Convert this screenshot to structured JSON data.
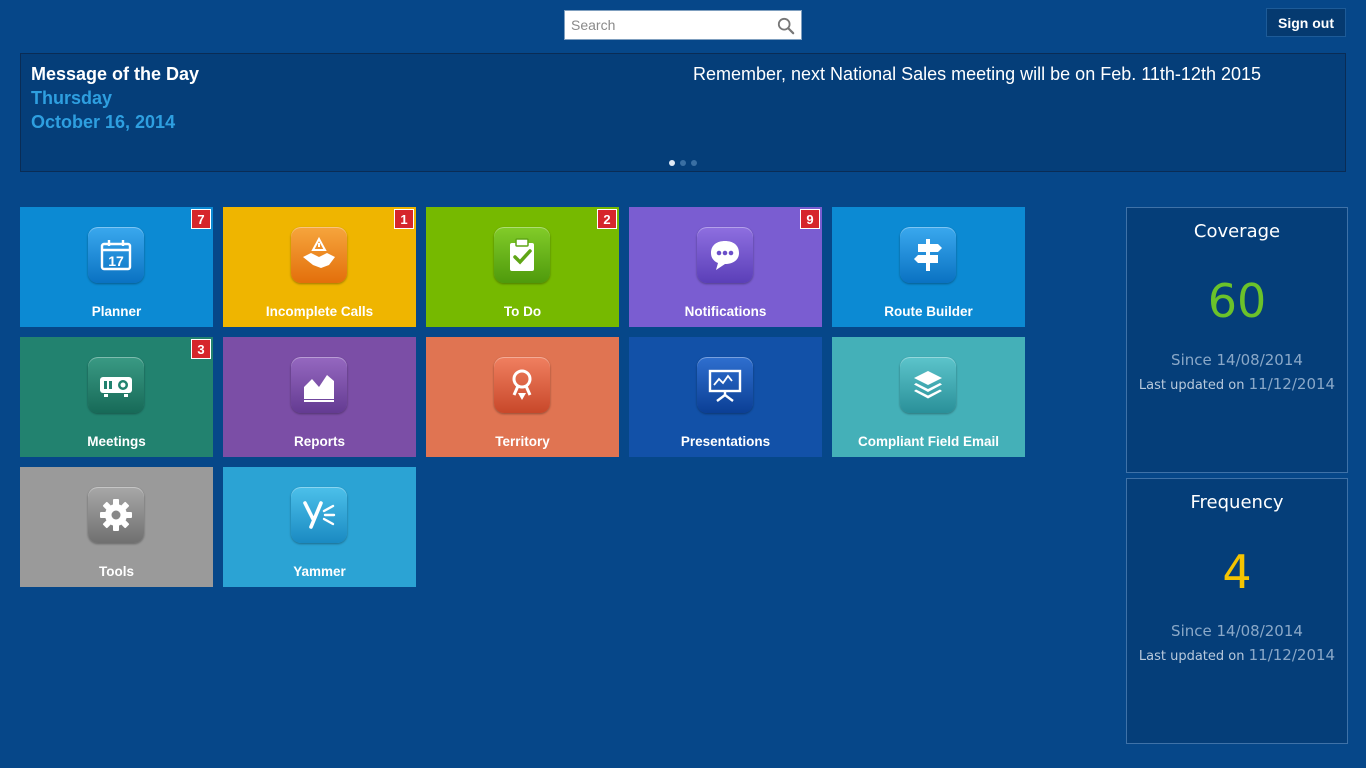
{
  "header": {
    "search_placeholder": "Search",
    "sign_out_label": "Sign out"
  },
  "message_of_the_day": {
    "title": "Message of the Day",
    "day": "Thursday",
    "date": "October 16, 2014",
    "message": "Remember, next National Sales meeting will be on Feb. 11th-12th 2015",
    "pager_dots": 3,
    "active_dot": 1
  },
  "tiles": [
    {
      "label": "Planner",
      "badge": "7",
      "color": "#0c8ad3",
      "icon": "calendar-icon"
    },
    {
      "label": "Incomplete Calls",
      "badge": "1",
      "color": "#efb500",
      "icon": "handshake-icon"
    },
    {
      "label": "To Do",
      "badge": "2",
      "color": "#76b900",
      "icon": "clipboard-check-icon"
    },
    {
      "label": "Notifications",
      "badge": "9",
      "color": "#7a5dd1",
      "icon": "chat-bubble-icon"
    },
    {
      "label": "Route Builder",
      "badge": "",
      "color": "#0c8ad3",
      "icon": "signpost-icon"
    },
    {
      "label": "Meetings",
      "badge": "3",
      "color": "#22826f",
      "icon": "projector-icon"
    },
    {
      "label": "Reports",
      "badge": "",
      "color": "#7b4ea6",
      "icon": "area-chart-icon"
    },
    {
      "label": "Territory",
      "badge": "",
      "color": "#e07452",
      "icon": "map-pin-icon"
    },
    {
      "label": "Presentations",
      "badge": "",
      "color": "#1251a8",
      "icon": "presentation-board-icon"
    },
    {
      "label": "Compliant Field Email",
      "badge": "",
      "color": "#44b0b8",
      "icon": "layers-mail-icon"
    },
    {
      "label": "Tools",
      "badge": "",
      "color": "#9a9a9a",
      "icon": "gear-icon"
    },
    {
      "label": "Yammer",
      "badge": "",
      "color": "#2ba3d4",
      "icon": "yammer-icon"
    }
  ],
  "stats": [
    {
      "title": "Coverage",
      "value": "60",
      "value_color": "#6bc22a",
      "since": "Since 14/08/2014",
      "updated_prefix": "Last updated on ",
      "updated_date": "11/12/2014"
    },
    {
      "title": "Frequency",
      "value": "4",
      "value_color": "#f5c400",
      "since": "Since 14/08/2014",
      "updated_prefix": "Last updated on ",
      "updated_date": "11/12/2014"
    }
  ]
}
